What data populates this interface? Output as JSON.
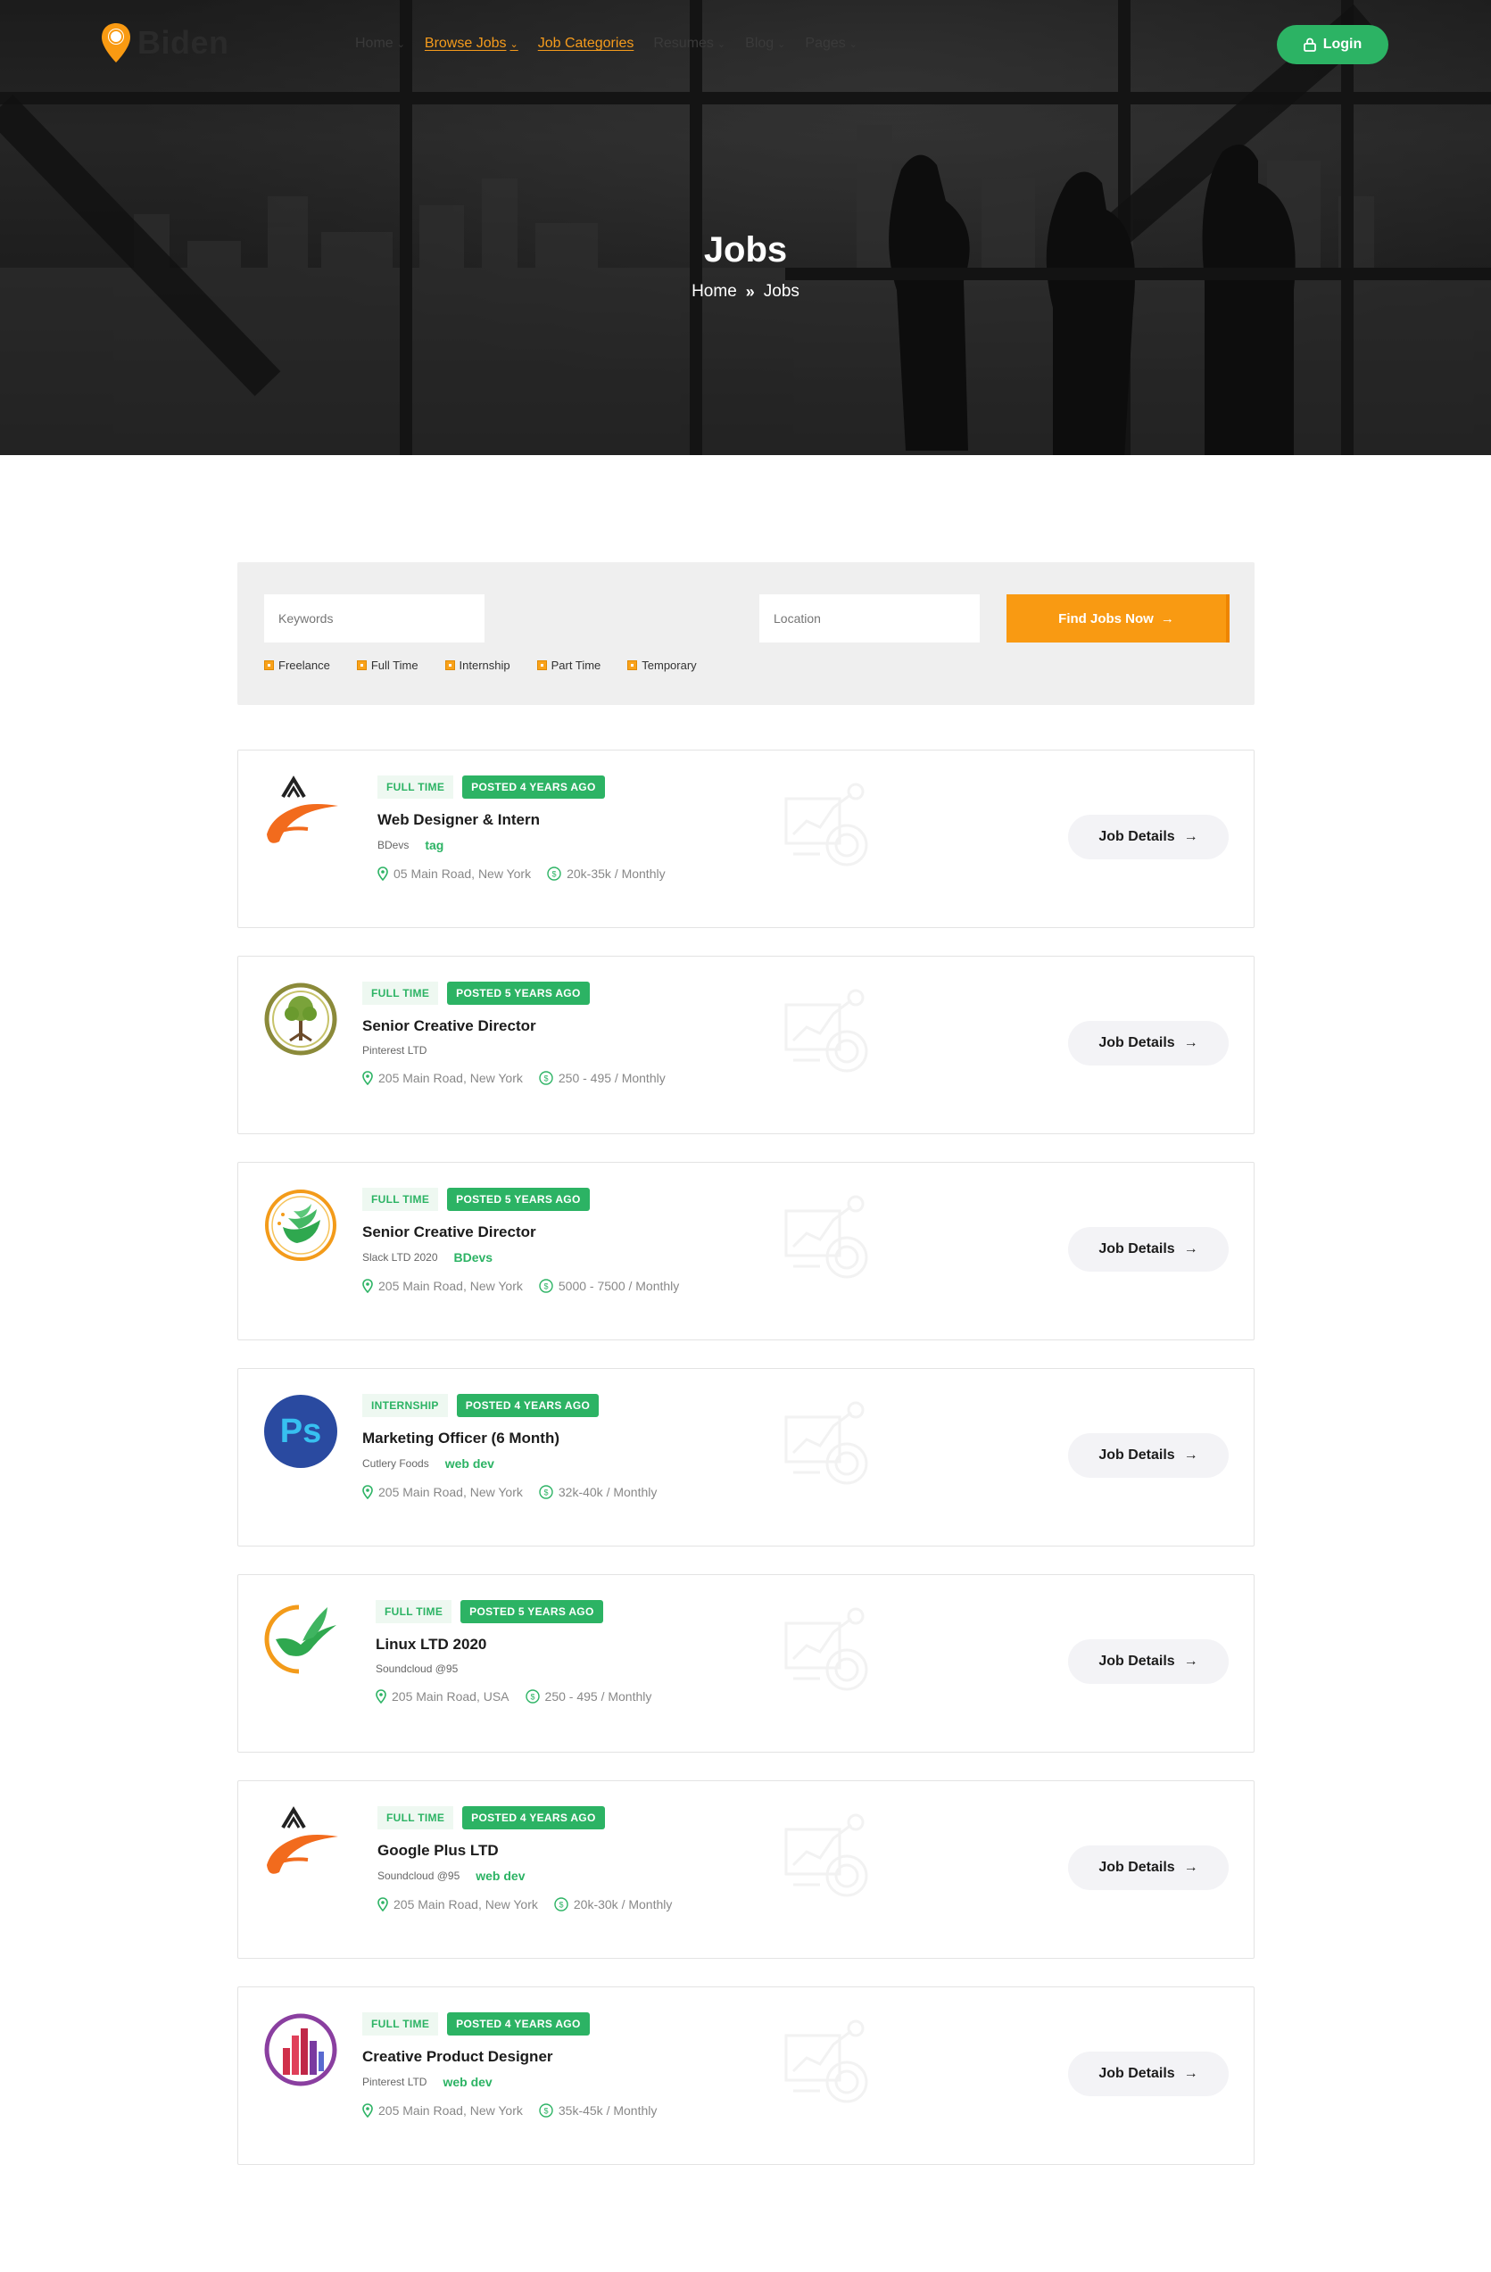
{
  "site": {
    "brand": "Biden"
  },
  "nav": {
    "items": [
      {
        "label": "Home",
        "active": false,
        "dropdown": true
      },
      {
        "label": "Browse Jobs",
        "active": true,
        "dropdown": true
      },
      {
        "label": "Job Categories",
        "active": true,
        "dropdown": false
      },
      {
        "label": "Resumes",
        "active": false,
        "dropdown": true
      },
      {
        "label": "Blog",
        "active": false,
        "dropdown": true
      },
      {
        "label": "Pages",
        "active": false,
        "dropdown": true
      }
    ],
    "login_label": "Login"
  },
  "hero": {
    "title": "Jobs",
    "breadcrumb": [
      "Home",
      "Jobs"
    ]
  },
  "search": {
    "keywords_placeholder": "Keywords",
    "location_placeholder": "Location",
    "button_label": "Find Jobs Now",
    "filters": [
      "Freelance",
      "Full Time",
      "Internship",
      "Part Time",
      "Temporary"
    ]
  },
  "jobs": [
    {
      "type": "FULL TIME",
      "posted": "POSTED 4 YEARS AGO",
      "title": "Web Designer & Intern",
      "company": "BDevs",
      "tag": "tag",
      "location": "05 Main Road, New York",
      "salary": "20k-35k / Monthly",
      "logo": "a-swoosh-logo"
    },
    {
      "type": "FULL TIME",
      "posted": "POSTED 5 YEARS AGO",
      "title": "Senior Creative Director",
      "company": "Pinterest LTD",
      "tag": "",
      "location": "205 Main Road, New York",
      "salary": "250 - 495 / Monthly",
      "logo": "tree-logo"
    },
    {
      "type": "FULL TIME",
      "posted": "POSTED 5 YEARS AGO",
      "title": "Senior Creative Director",
      "company": "Slack LTD 2020",
      "tag": "BDevs",
      "location": "205 Main Road, New York",
      "salary": "5000 - 7500 / Monthly",
      "logo": "wing-circle-logo"
    },
    {
      "type": "INTERNSHIP",
      "posted": "POSTED 4 YEARS AGO",
      "title": "Marketing Officer (6 Month)",
      "company": "Cutlery Foods",
      "tag": "web dev",
      "location": "205 Main Road, New York",
      "salary": "32k-40k / Monthly",
      "logo": "ps-logo"
    },
    {
      "type": "FULL TIME",
      "posted": "POSTED 5 YEARS AGO",
      "title": "Linux LTD 2020",
      "company": "Soundcloud @95",
      "tag": "",
      "location": "205 Main Road, USA",
      "salary": "250 - 495 / Monthly",
      "logo": "bird-logo"
    },
    {
      "type": "FULL TIME",
      "posted": "POSTED 4 YEARS AGO",
      "title": "Google Plus LTD",
      "company": "Soundcloud @95",
      "tag": "web dev",
      "location": "205 Main Road, New York",
      "salary": "20k-30k / Monthly",
      "logo": "a-swoosh-logo"
    },
    {
      "type": "FULL TIME",
      "posted": "POSTED 4 YEARS AGO",
      "title": "Creative Product Designer",
      "company": "Pinterest LTD",
      "tag": "web dev",
      "location": "205 Main Road, New York",
      "salary": "35k-45k / Monthly",
      "logo": "bars-circle-logo"
    }
  ],
  "job_details_label": "Job Details",
  "colors": {
    "accent_orange": "#f99a12",
    "accent_green": "#2cb364",
    "search_bg": "#efefef"
  }
}
